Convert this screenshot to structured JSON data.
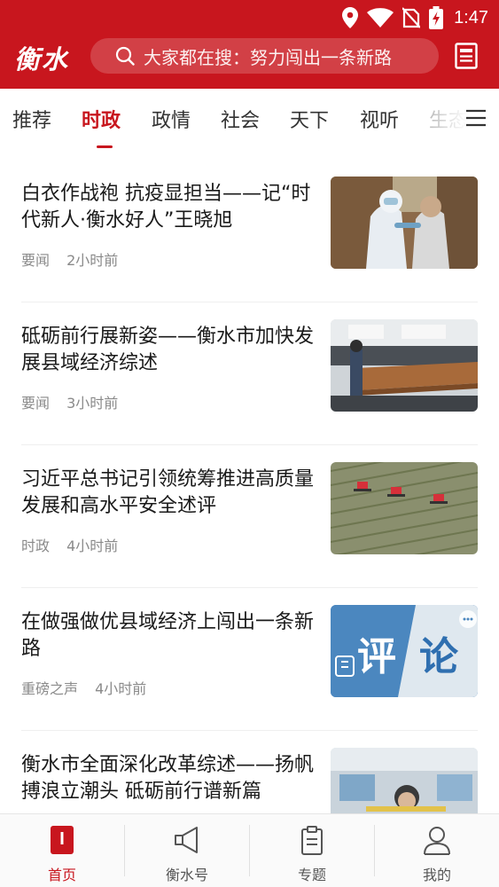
{
  "status_bar": {
    "time": "1:47",
    "icons": [
      "location-icon",
      "wifi-icon",
      "no-sim-icon",
      "battery-charging-icon"
    ]
  },
  "header": {
    "logo": "衡水",
    "search_placeholder": "大家都在搜：努力闯出一条新路",
    "right_icon": "newspaper-icon"
  },
  "tabs": {
    "items": [
      "推荐",
      "时政",
      "政情",
      "社会",
      "天下",
      "视听",
      "生态"
    ],
    "active": "时政",
    "menu_icon": "menu-icon"
  },
  "news": [
    {
      "title": "白衣作战袍 抗疫显担当——记“时代新人·衡水好人”王晓旭",
      "category": "要闻",
      "time": "2小时前",
      "image": "medical-worker-photo"
    },
    {
      "title": "砥砺前行展新姿——衡水市加快发展县域经济综述",
      "category": "要闻",
      "time": "3小时前",
      "image": "factory-wood-panel-photo"
    },
    {
      "title": "习近平总书记引领统筹推进高质量发展和高水平安全述评",
      "category": "时政",
      "time": "4小时前",
      "image": "farm-tractors-photo"
    },
    {
      "title": "在做强做优县域经济上闯出一条新路",
      "category": "重磅之声",
      "time": "4小时前",
      "image": "commentary-graphic",
      "image_text": [
        "评",
        "论"
      ]
    },
    {
      "title": "衡水市全面深化改革综述——扬帆搏浪立潮头 砥砺前行谱新篇",
      "category": "",
      "time": "",
      "image": "office-service-photo"
    }
  ],
  "bottom_nav": [
    {
      "label": "首页",
      "icon": "home-icon",
      "active": true
    },
    {
      "label": "衡水号",
      "icon": "megaphone-icon",
      "active": false
    },
    {
      "label": "专题",
      "icon": "clipboard-icon",
      "active": false
    },
    {
      "label": "我的",
      "icon": "user-icon",
      "active": false
    }
  ],
  "colors": {
    "brand_red": "#c8161e",
    "meta_gray": "#8a8a8a"
  }
}
